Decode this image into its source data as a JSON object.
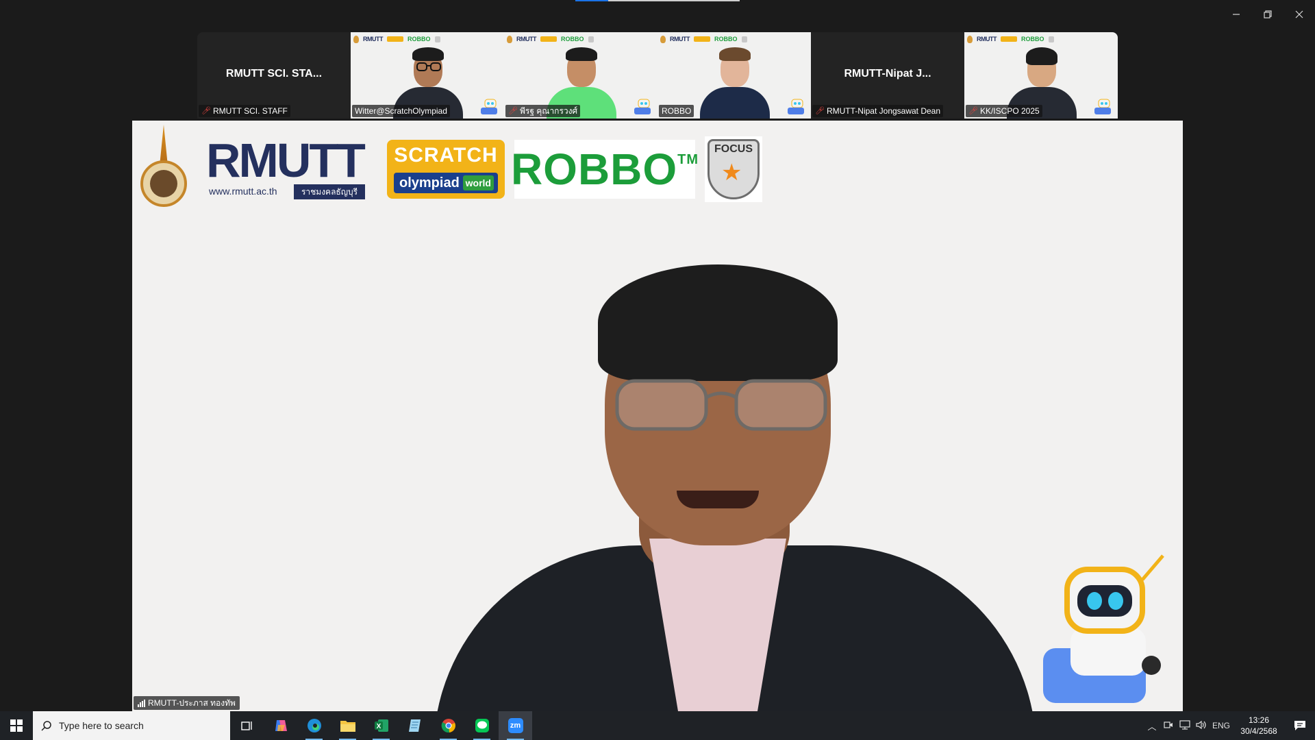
{
  "window": {
    "controls": {
      "minimize": "—",
      "restore": "❐",
      "close": "✕"
    }
  },
  "gallery": {
    "tiles": [
      {
        "type": "name",
        "display_name": "RMUTT SCI. STA...",
        "label": "RMUTT SCI. STAFF",
        "muted": true
      },
      {
        "type": "video",
        "label": "Witter@ScratchOlympiad",
        "muted": false,
        "robot": true
      },
      {
        "type": "video",
        "label": "พีรฐ  คุณากรวงศ์",
        "muted": true,
        "robot": true
      },
      {
        "type": "video",
        "label": "ROBBO",
        "muted": false,
        "robot": true
      },
      {
        "type": "name",
        "display_name": "RMUTT-Nipat J...",
        "label": "RMUTT-Nipat Jongsawat Dean",
        "muted": true
      },
      {
        "type": "video",
        "label": "KK/ISCPO 2025",
        "muted": true,
        "robot": true
      }
    ],
    "mini_logos": {
      "rmutt": "RMUTT",
      "robbo": "ROBBO"
    }
  },
  "main_video": {
    "logos": {
      "rmutt_word": "RMUTT",
      "rmutt_url": "www.rmutt.ac.th",
      "rmutt_thai": "ราชมงคลธัญบุรี",
      "scratch_top": "SCRATCH",
      "scratch_bottom": "olympiad",
      "scratch_world": "world",
      "robbo": "ROBBO",
      "robbo_tm": "TM",
      "focus": "FOCUS"
    },
    "speaker_label": "RMUTT-ประภาส ทองทัพ"
  },
  "taskbar": {
    "search_placeholder": "Type here to search",
    "apps": [
      "task-view",
      "copilot",
      "edge",
      "file-explorer",
      "excel",
      "notepad",
      "chrome",
      "line",
      "zoom"
    ],
    "active_app": "zoom",
    "zoom_label": "zm",
    "tray": {
      "language": "ENG",
      "time": "13:26",
      "date": "30/4/2568"
    }
  },
  "colors": {
    "window_bg": "#1b1b1b",
    "video_bg": "#f2f1f0",
    "rmutt_navy": "#24305e",
    "scratch_yellow": "#f2b318",
    "robbo_green": "#1c9d3a",
    "muted_red": "#e0433f",
    "taskbar_bg": "#1f2226"
  }
}
